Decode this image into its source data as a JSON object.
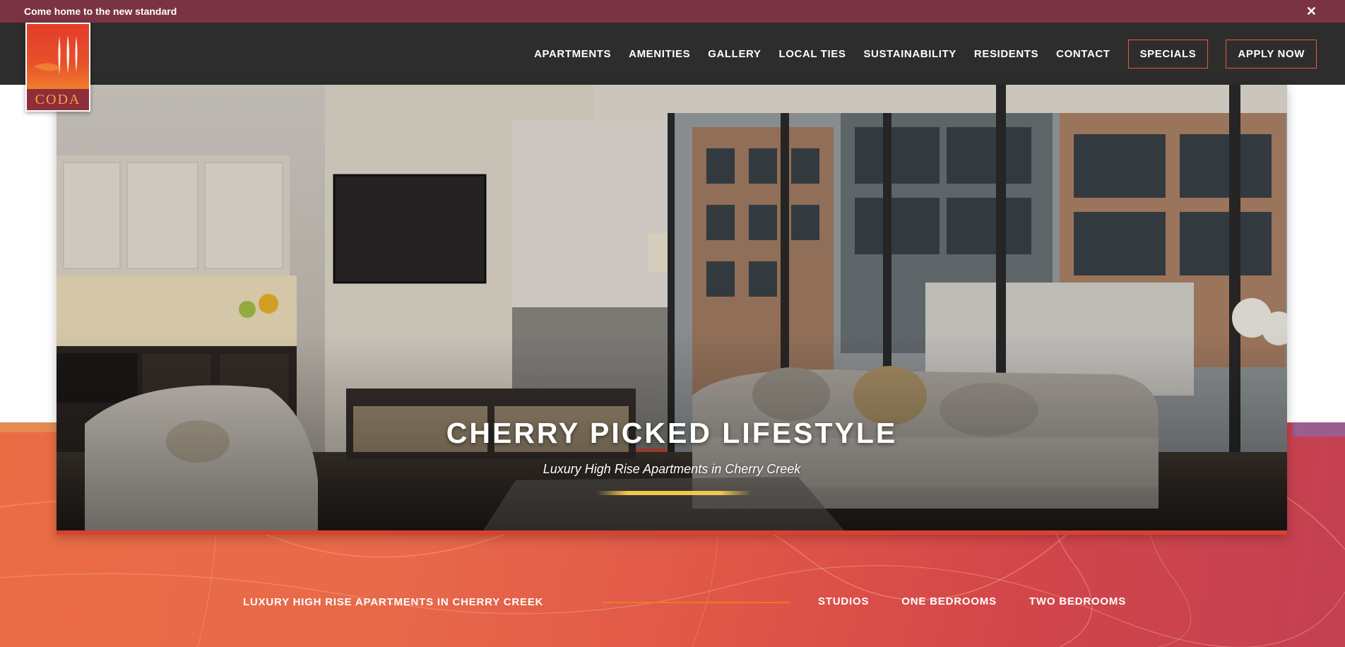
{
  "announcement": {
    "text": "Come home to the new standard",
    "close_glyph": "✕"
  },
  "logo": {
    "text": "CODA"
  },
  "nav": {
    "items": [
      "APARTMENTS",
      "AMENITIES",
      "GALLERY",
      "LOCAL TIES",
      "SUSTAINABILITY",
      "RESIDENTS",
      "CONTACT"
    ],
    "specials_label": "SPECIALS",
    "apply_label": "APPLY NOW"
  },
  "hero": {
    "title": "CHERRY PICKED LIFESTYLE",
    "subtitle": "Luxury High Rise Apartments in Cherry Creek"
  },
  "band": {
    "label": "LUXURY HIGH RISE APARTMENTS IN CHERRY CREEK",
    "links": [
      "STUDIOS",
      "ONE BEDROOMS",
      "TWO BEDROOMS"
    ]
  },
  "colors": {
    "announcement_bg": "#7a3343",
    "header_bg": "#2d2d2d",
    "accent": "#e25a3b",
    "band_orange": "#e8694a"
  },
  "icons": {
    "close": "close-icon",
    "logo_mark": "coda-logo"
  }
}
